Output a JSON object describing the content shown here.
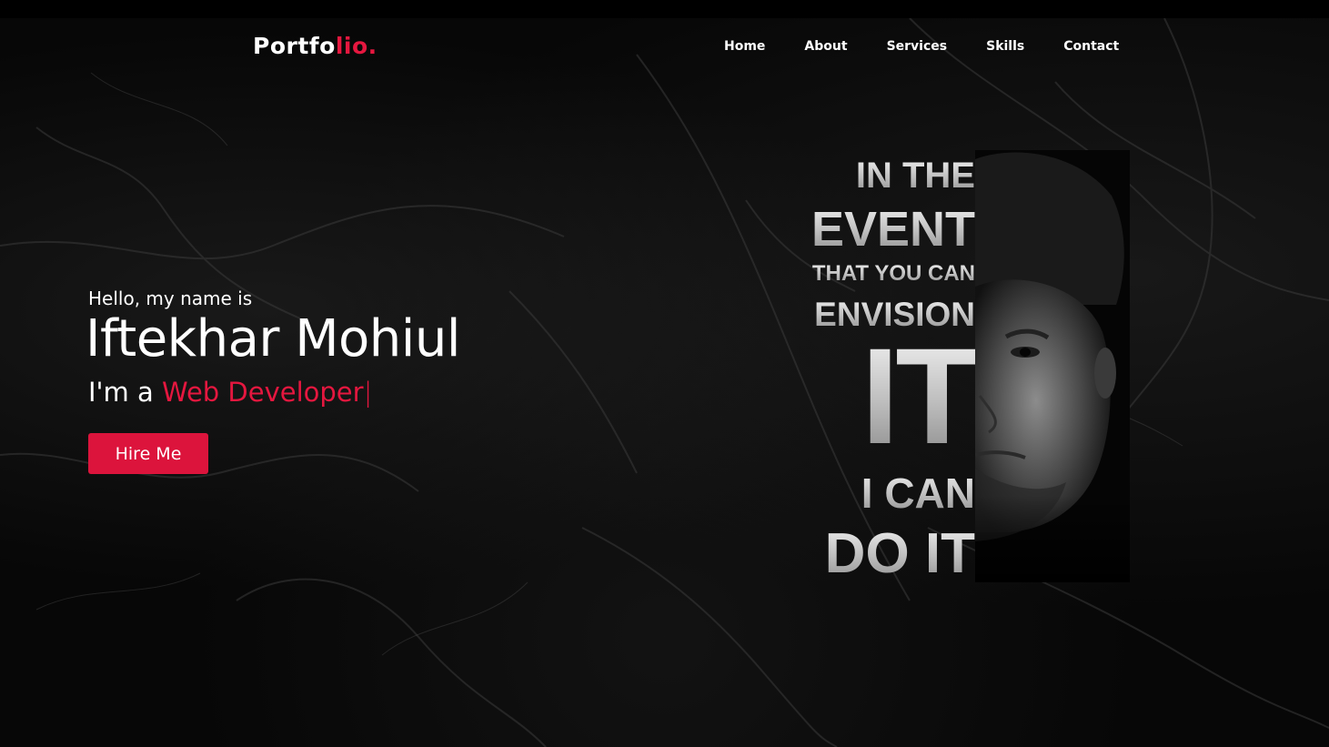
{
  "nav": {
    "logo_main": "Portfo",
    "logo_accent": "lio.",
    "items": [
      "Home",
      "About",
      "Services",
      "Skills",
      "Contact"
    ]
  },
  "hero": {
    "greeting": "Hello, my name is",
    "name": "Iftekhar Mohiul",
    "role_prefix": "I'm a",
    "role_highlight": "Web Developer",
    "cursor": "|",
    "cta_label": "Hire Me"
  },
  "poster": {
    "lines": [
      "IN THE",
      "EVENT",
      "THAT YOU CAN",
      "ENVISION",
      "IT",
      "I CAN",
      "DO IT"
    ]
  },
  "colors": {
    "accent": "#e5173f",
    "background": "#070707",
    "text": "#ffffff"
  }
}
